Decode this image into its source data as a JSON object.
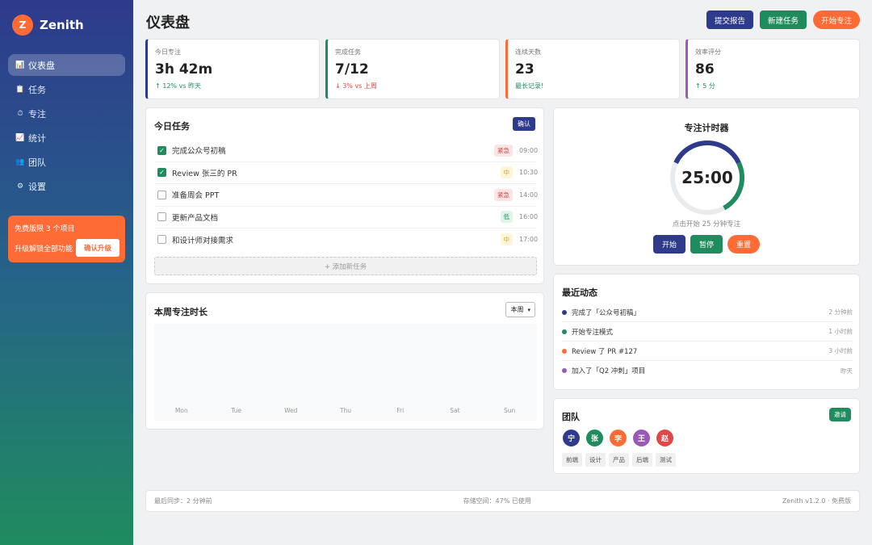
{
  "brand": {
    "logo_letter": "Z",
    "name": "Zenith"
  },
  "sidebar": {
    "items": [
      {
        "icon": "📊",
        "label": "仪表盘",
        "active": true
      },
      {
        "icon": "📋",
        "label": "任务",
        "active": false
      },
      {
        "icon": "⏱",
        "label": "专注",
        "active": false
      },
      {
        "icon": "📈",
        "label": "统计",
        "active": false
      },
      {
        "icon": "👥",
        "label": "团队",
        "active": false
      },
      {
        "icon": "⚙",
        "label": "设置",
        "active": false
      }
    ],
    "promo": {
      "line1": "免费版限 3 个项目",
      "line2": "升级解锁全部功能",
      "button": "确认升级"
    }
  },
  "header": {
    "title": "仪表盘",
    "actions": [
      "提交报告",
      "新建任务",
      "开始专注"
    ]
  },
  "stats": [
    {
      "label": "今日专注",
      "value": "3h 42m",
      "sub": "↑ 12% vs 昨天",
      "color": "#2e3a8c",
      "sub_color": "#1f8c5e"
    },
    {
      "label": "完成任务",
      "value": "7/12",
      "sub": "↓ 3% vs 上周",
      "color": "#1f8c5e",
      "sub_color": "#d94a4a"
    },
    {
      "label": "连续天数",
      "value": "23",
      "sub": "最长记录!",
      "color": "#ff6b35",
      "sub_color": "#1f8c5e"
    },
    {
      "label": "效率评分",
      "value": "86",
      "sub": "↑ 5 分",
      "color": "#9b59b6",
      "sub_color": "#1f8c5e"
    }
  ],
  "tasks": {
    "title": "今日任务",
    "tag_button": "确认",
    "items": [
      {
        "text": "完成公众号初稿",
        "priority": "紧急",
        "level": "high",
        "time": "09:00",
        "checked": true
      },
      {
        "text": "Review 张三的 PR",
        "priority": "中",
        "level": "mid",
        "time": "10:30",
        "checked": true
      },
      {
        "text": "准备周会 PPT",
        "priority": "紧急",
        "level": "high",
        "time": "14:00",
        "checked": false
      },
      {
        "text": "更新产品文档",
        "priority": "低",
        "level": "low",
        "time": "16:00",
        "checked": false
      },
      {
        "text": "和设计师对接需求",
        "priority": "中",
        "level": "mid",
        "time": "17:00",
        "checked": false
      }
    ],
    "add_label": "+ 添加新任务"
  },
  "weekly": {
    "title": "本周专注时长",
    "select_value": "本周"
  },
  "chart_data": {
    "type": "bar",
    "title": "本周专注时长",
    "categories": [
      "Mon",
      "Tue",
      "Wed",
      "Thu",
      "Fri",
      "Sat",
      "Sun"
    ],
    "values": [],
    "xlabel": "",
    "ylabel": ""
  },
  "timer": {
    "title": "专注计时器",
    "time": "25:00",
    "progress": 0.4,
    "hint": "点击开始 25 分钟专注",
    "buttons": [
      {
        "label": "开始",
        "color": "#2e3a8c"
      },
      {
        "label": "暂停",
        "color": "#1f8c5e"
      },
      {
        "label": "重置",
        "color": "#ff6b35"
      }
    ]
  },
  "activity": {
    "title": "最近动态",
    "items": [
      {
        "text": "完成了「公众号初稿」",
        "time": "2 分钟前",
        "color": "#2e3a8c"
      },
      {
        "text": "开始专注模式",
        "time": "1 小时前",
        "color": "#1f8c5e"
      },
      {
        "text": "Review 了 PR #127",
        "time": "3 小时前",
        "color": "#ff6b35"
      },
      {
        "text": "加入了「Q2 冲刺」项目",
        "time": "昨天",
        "color": "#9b59b6"
      }
    ]
  },
  "team": {
    "title": "团队",
    "invite": "邀请",
    "members": [
      {
        "initial": "宁",
        "color": "#2e3a8c"
      },
      {
        "initial": "张",
        "color": "#1f8c5e"
      },
      {
        "initial": "李",
        "color": "#ff6b35"
      },
      {
        "initial": "王",
        "color": "#9b59b6"
      },
      {
        "initial": "赵",
        "color": "#e04848"
      }
    ],
    "roles": [
      "前端",
      "设计",
      "产品",
      "后端",
      "测试"
    ]
  },
  "footer": {
    "sync": "最后同步：2 分钟前",
    "storage": "存储空间：47% 已使用",
    "version": "Zenith v1.2.0 · 免费版"
  }
}
